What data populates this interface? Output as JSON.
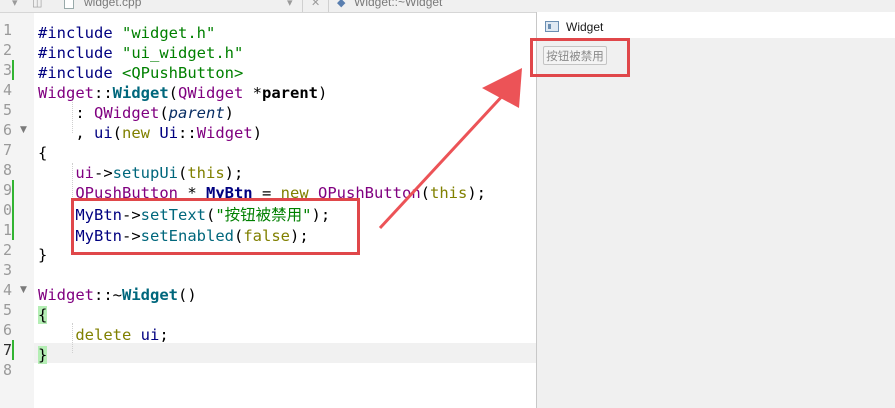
{
  "tab_bar": {
    "file_tab_label": "widget.cpp",
    "symbol_label": "Widget::~Widget"
  },
  "editor": {
    "line_numbers": [
      "1",
      "2",
      "3",
      "4",
      "5",
      "6",
      "7",
      "8",
      "9",
      "0",
      "1",
      "2",
      "3",
      "4",
      "5",
      "6",
      "7",
      "8"
    ],
    "current_line_number": "7"
  },
  "widget_window": {
    "title": "Widget",
    "disabled_button_label": "按钮被禁用"
  },
  "colors": {
    "highlight_box": "#e0474a",
    "arrow": "#ec5357",
    "modified_bar": "#32b432"
  }
}
